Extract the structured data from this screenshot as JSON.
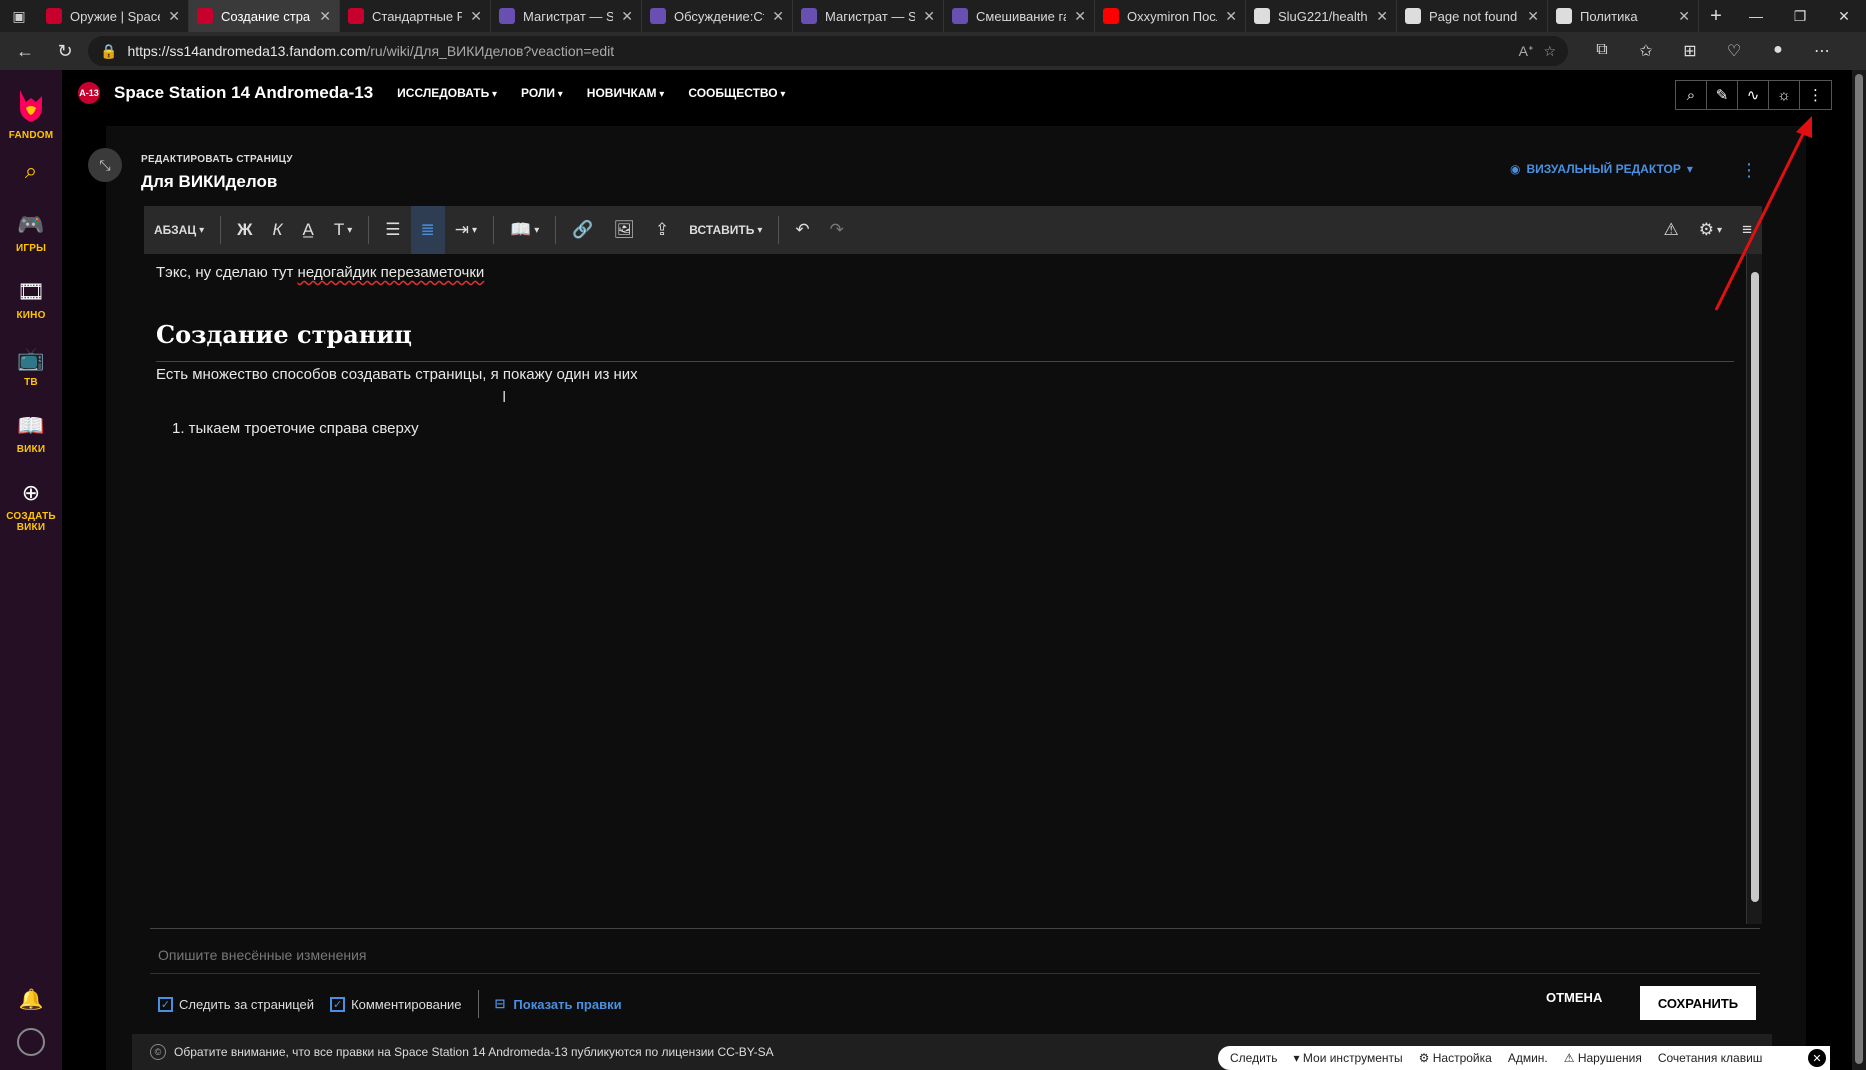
{
  "browser": {
    "tabs": [
      {
        "title": "Оружие | Space",
        "favicon_color": "#c8002d",
        "active": false
      },
      {
        "title": "Создание стран",
        "favicon_color": "#c8002d",
        "active": true
      },
      {
        "title": "Стандартные Р",
        "favicon_color": "#c8002d",
        "active": false
      },
      {
        "title": "Магистрат — S",
        "favicon_color": "#6a4fb3",
        "active": false
      },
      {
        "title": "Обсуждение:Ст",
        "favicon_color": "#6a4fb3",
        "active": false
      },
      {
        "title": "Магистрат — S",
        "favicon_color": "#6a4fb3",
        "active": false
      },
      {
        "title": "Смешивание га",
        "favicon_color": "#6a4fb3",
        "active": false
      },
      {
        "title": "Oxxymiron Посл",
        "favicon_color": "#ff0000",
        "active": false
      },
      {
        "title": "SluG221/health",
        "favicon_color": "#dddddd",
        "active": false
      },
      {
        "title": "Page not found",
        "favicon_color": "#dddddd",
        "active": false
      },
      {
        "title": "Политика",
        "favicon_color": "#dddddd",
        "active": false
      }
    ],
    "url_host": "https://ss14andromeda13.fandom.com",
    "url_path": "/ru/wiki/Для_ВИКИделов?veaction=edit"
  },
  "rail": {
    "logo_label": "FANDOM",
    "items": [
      {
        "icon": "gamepad-icon",
        "label": "ИГРЫ"
      },
      {
        "icon": "film-icon",
        "label": "КИНО"
      },
      {
        "icon": "tv-icon",
        "label": "ТВ"
      },
      {
        "icon": "book-icon",
        "label": "ВИКИ"
      },
      {
        "icon": "plus-circle-icon",
        "label": "СОЗДАТЬ ВИКИ"
      }
    ]
  },
  "wiki": {
    "logo_text": "A-13",
    "name": "Space Station 14 Andromeda-13",
    "nav": [
      "ИССЛЕДОВАТЬ",
      "РОЛИ",
      "НОВИЧКАМ",
      "СООБЩЕСТВО"
    ]
  },
  "editor": {
    "caption": "РЕДАКТИРОВАТЬ СТРАНИЦУ",
    "page_title": "Для ВИКИделов",
    "mode_label": "ВИЗУАЛЬНЫЙ РЕДАКТОР",
    "toolbar": {
      "paragraph": "АБЗАЦ",
      "bold": "Ж",
      "italic": "К",
      "insert": "ВСТАВИТЬ"
    },
    "content": {
      "p1_plain": "Тэкс, ну сделаю тут ",
      "p1_marked": "недогайдик перезаметочки",
      "heading": "Создание страниц",
      "p2": "Есть множество способов создавать страницы, я покажу один из них",
      "list_item": "1.  тыкаем троеточие справа сверху"
    },
    "summary_placeholder": "Опишите внесённые изменения",
    "watch_label": "Следить за страницей",
    "comment_label": "Комментирование",
    "show_changes": "Показать правки",
    "cancel": "ОТМЕНА",
    "save": "СОХРАНИТЬ",
    "license": "Обратите внимание, что все правки на Space Station 14 Andromeda-13 публикуются по лицензии CC-BY-SA"
  },
  "bottom_toolbar": {
    "follow": "Следить",
    "tools": "Мои инструменты",
    "settings": "Настройка",
    "admin": "Админ.",
    "violations": "Нарушения",
    "shortcuts": "Сочетания клавиш"
  },
  "colors": {
    "accent": "#4a90e2",
    "rail_bg": "#240f25",
    "fandom_yellow": "#ffc500",
    "annotation_arrow": "#e01010"
  }
}
